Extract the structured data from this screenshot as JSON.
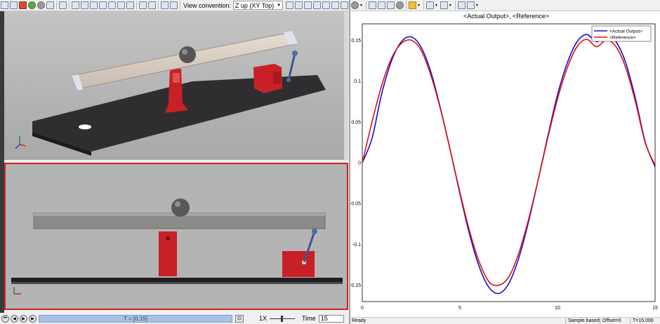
{
  "left_toolbar": {
    "view_convention_label": "View convention:",
    "view_convention_value": "Z up (XY Top)"
  },
  "scope": {
    "title": "<Actual Output>, <Reference>",
    "colors": {
      "actual": "#1010d0",
      "reference": "#e01010"
    }
  },
  "chart_data": {
    "type": "line",
    "title": "<Actual Output>, <Reference>",
    "xlabel": "",
    "ylabel": "",
    "xlim": [
      0,
      15
    ],
    "ylim": [
      -0.17,
      0.17
    ],
    "xticks": [
      "0",
      "5",
      "10",
      "15"
    ],
    "yticks": [
      "0.15",
      "0.1",
      "0.05",
      "0",
      "-0.05",
      "-0.1",
      "-0.15"
    ],
    "grid": true,
    "legend_position": "top-right",
    "series": [
      {
        "name": "<Actual Output>",
        "color": "#1010d0",
        "x": [
          0,
          0.5,
          1,
          1.5,
          2,
          2.5,
          3,
          3.5,
          4,
          4.5,
          5,
          5.5,
          6,
          6.5,
          7,
          7.5,
          8,
          8.5,
          9,
          9.5,
          10,
          10.5,
          11,
          11.5,
          12,
          12.5,
          13,
          13.5,
          14,
          14.5,
          15
        ],
        "y": [
          0,
          0.03,
          0.085,
          0.125,
          0.148,
          0.154,
          0.142,
          0.112,
          0.067,
          0.016,
          -0.038,
          -0.088,
          -0.128,
          -0.153,
          -0.16,
          -0.148,
          -0.118,
          -0.074,
          -0.022,
          0.032,
          0.083,
          0.122,
          0.148,
          0.157,
          0.148,
          0.155,
          0.148,
          0.122,
          0.078,
          0.025,
          -0.005
        ]
      },
      {
        "name": "<Reference>",
        "color": "#e01010",
        "x": [
          0,
          0.5,
          1,
          1.5,
          2,
          2.5,
          3,
          3.5,
          4,
          4.5,
          5,
          5.5,
          6,
          6.5,
          7,
          7.5,
          8,
          8.5,
          9,
          9.5,
          10,
          10.5,
          11,
          11.5,
          12,
          12.5,
          13,
          13.5,
          14,
          14.5,
          15
        ],
        "y": [
          0,
          0.05,
          0.095,
          0.128,
          0.146,
          0.15,
          0.138,
          0.108,
          0.066,
          0.016,
          -0.036,
          -0.084,
          -0.122,
          -0.146,
          -0.15,
          -0.14,
          -0.112,
          -0.071,
          -0.022,
          0.03,
          0.078,
          0.116,
          0.142,
          0.151,
          0.142,
          0.15,
          0.142,
          0.116,
          0.074,
          0.024,
          -0.003
        ]
      }
    ]
  },
  "sim_controls": {
    "time_range": "T = [0,15]",
    "speed": "1X",
    "time_label": "Time",
    "time_value": "15"
  },
  "status": {
    "ready": "Ready",
    "mode": "Sample based",
    "offset": "Offset=0",
    "time": "T=15.000"
  }
}
